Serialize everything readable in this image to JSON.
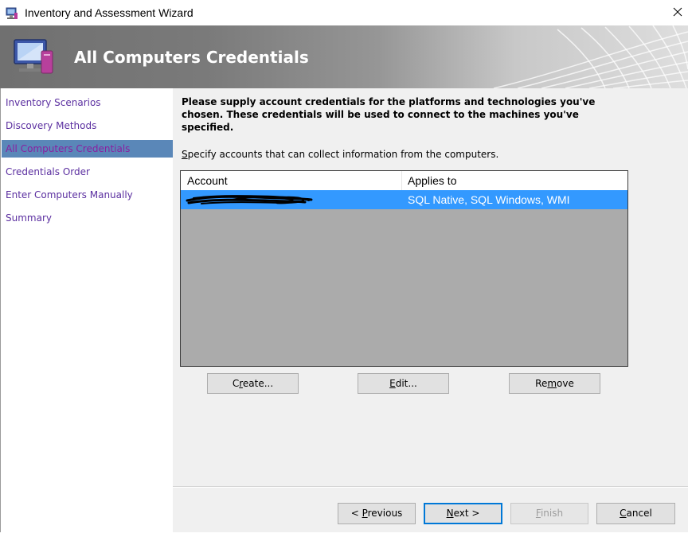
{
  "window": {
    "title": "Inventory and Assessment Wizard",
    "close_icon": "close-icon",
    "app_icon": "computer-icon"
  },
  "banner": {
    "title": "All Computers Credentials",
    "icon": "computer-monitor-icon"
  },
  "nav": {
    "items": [
      {
        "label": "Inventory Scenarios",
        "active": false
      },
      {
        "label": "Discovery Methods",
        "active": false
      },
      {
        "label": "All Computers Credentials",
        "active": true
      },
      {
        "label": "Credentials Order",
        "active": false
      },
      {
        "label": "Enter Computers Manually",
        "active": false
      },
      {
        "label": "Summary",
        "active": false
      }
    ]
  },
  "content": {
    "intro": "Please supply account credentials for the platforms and technologies you've chosen. These credentials will be used to connect to the machines you've specified.",
    "specify_mnemonic": "S",
    "specify_rest": "pecify accounts that can collect information from the computers.",
    "list": {
      "columns": [
        "Account",
        "Applies to"
      ],
      "rows": [
        {
          "account": "",
          "applies_to": "SQL Native, SQL Windows, WMI",
          "selected": true
        }
      ]
    },
    "buttons": {
      "create": {
        "pre": "C",
        "mn": "r",
        "post": "eate..."
      },
      "edit": {
        "pre": "",
        "mn": "E",
        "post": "dit..."
      },
      "remove": {
        "pre": "Re",
        "mn": "m",
        "post": "ove"
      }
    }
  },
  "footer": {
    "previous": {
      "pre": "< ",
      "mn": "P",
      "post": "revious"
    },
    "next": {
      "pre": "",
      "mn": "N",
      "post": "ext >"
    },
    "finish": {
      "pre": "",
      "mn": "F",
      "post": "inish",
      "enabled": false
    },
    "cancel": {
      "pre": "",
      "mn": "C",
      "post": "ancel"
    }
  },
  "colors": {
    "nav_link": "#5b2fa0",
    "nav_active_bg": "#5a87b8",
    "selection": "#3399ff",
    "list_bg": "#ababab",
    "content_bg": "#f0f0f0"
  }
}
